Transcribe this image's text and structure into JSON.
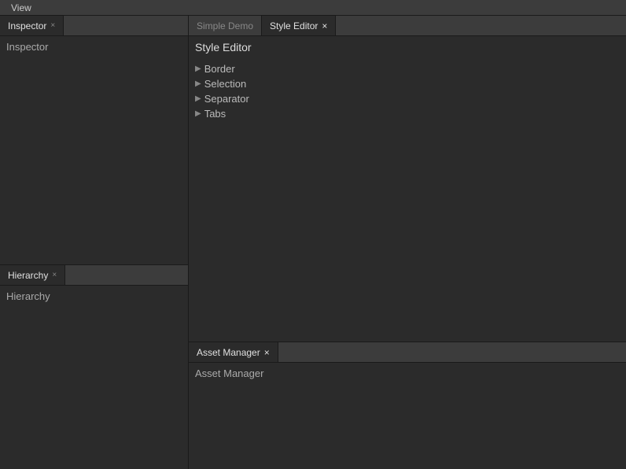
{
  "menubar": {
    "items": [
      {
        "label": "View"
      }
    ]
  },
  "left": {
    "inspector": {
      "tab_label": "Inspector",
      "close_label": "×",
      "panel_label": "Inspector"
    },
    "hierarchy": {
      "tab_label": "Hierarchy",
      "close_label": "×",
      "panel_label": "Hierarchy"
    }
  },
  "right": {
    "top": {
      "tabs": [
        {
          "label": "Simple Demo",
          "closable": false
        },
        {
          "label": "Style Editor",
          "closable": true,
          "active": true
        }
      ],
      "title": "Style Editor",
      "tree_items": [
        {
          "label": "Border"
        },
        {
          "label": "Selection"
        },
        {
          "label": "Separator"
        },
        {
          "label": "Tabs"
        }
      ]
    },
    "bottom": {
      "tab_label": "Asset Manager",
      "close_label": "×",
      "panel_label": "Asset Manager"
    }
  }
}
